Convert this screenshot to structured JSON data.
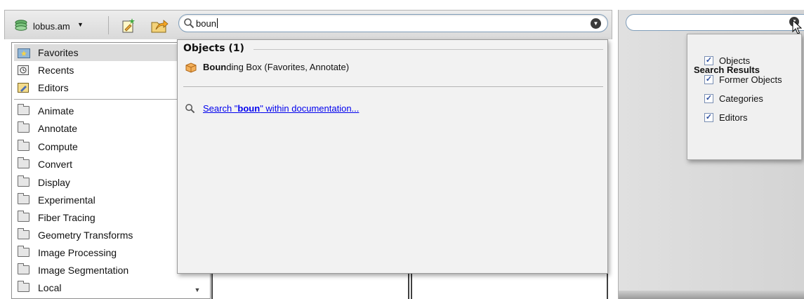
{
  "toolbar": {
    "server_label": "lobus.am",
    "search_value": "boun"
  },
  "categories": {
    "top": [
      {
        "label": "Favorites",
        "icon": "favorites-folder-icon",
        "selected": true
      },
      {
        "label": "Recents",
        "icon": "recents-clock-icon"
      },
      {
        "label": "Editors",
        "icon": "editors-icon"
      }
    ],
    "folders": [
      "Animate",
      "Annotate",
      "Compute",
      "Convert",
      "Display",
      "Experimental",
      "Fiber Tracing",
      "Geometry Transforms",
      "Image Processing",
      "Image Segmentation",
      "Local"
    ]
  },
  "popup": {
    "section_header": "Objects (1)",
    "result_bold": "Boun",
    "result_rest": "ding Box (Favorites, Annotate)",
    "doc_link_prefix": "Search \"",
    "doc_link_term": "boun",
    "doc_link_suffix": "\" within documentation..."
  },
  "search_results_menu": {
    "title": "Search Results",
    "options": [
      {
        "label": "Objects",
        "checked": true
      },
      {
        "label": "Former Objects",
        "checked": true
      },
      {
        "label": "Categories",
        "checked": true
      },
      {
        "label": "Editors",
        "checked": true
      }
    ]
  },
  "colors": {
    "link": "#0000ee",
    "checkmark": "#2a4c9e",
    "selection": "#dcdcdc"
  }
}
